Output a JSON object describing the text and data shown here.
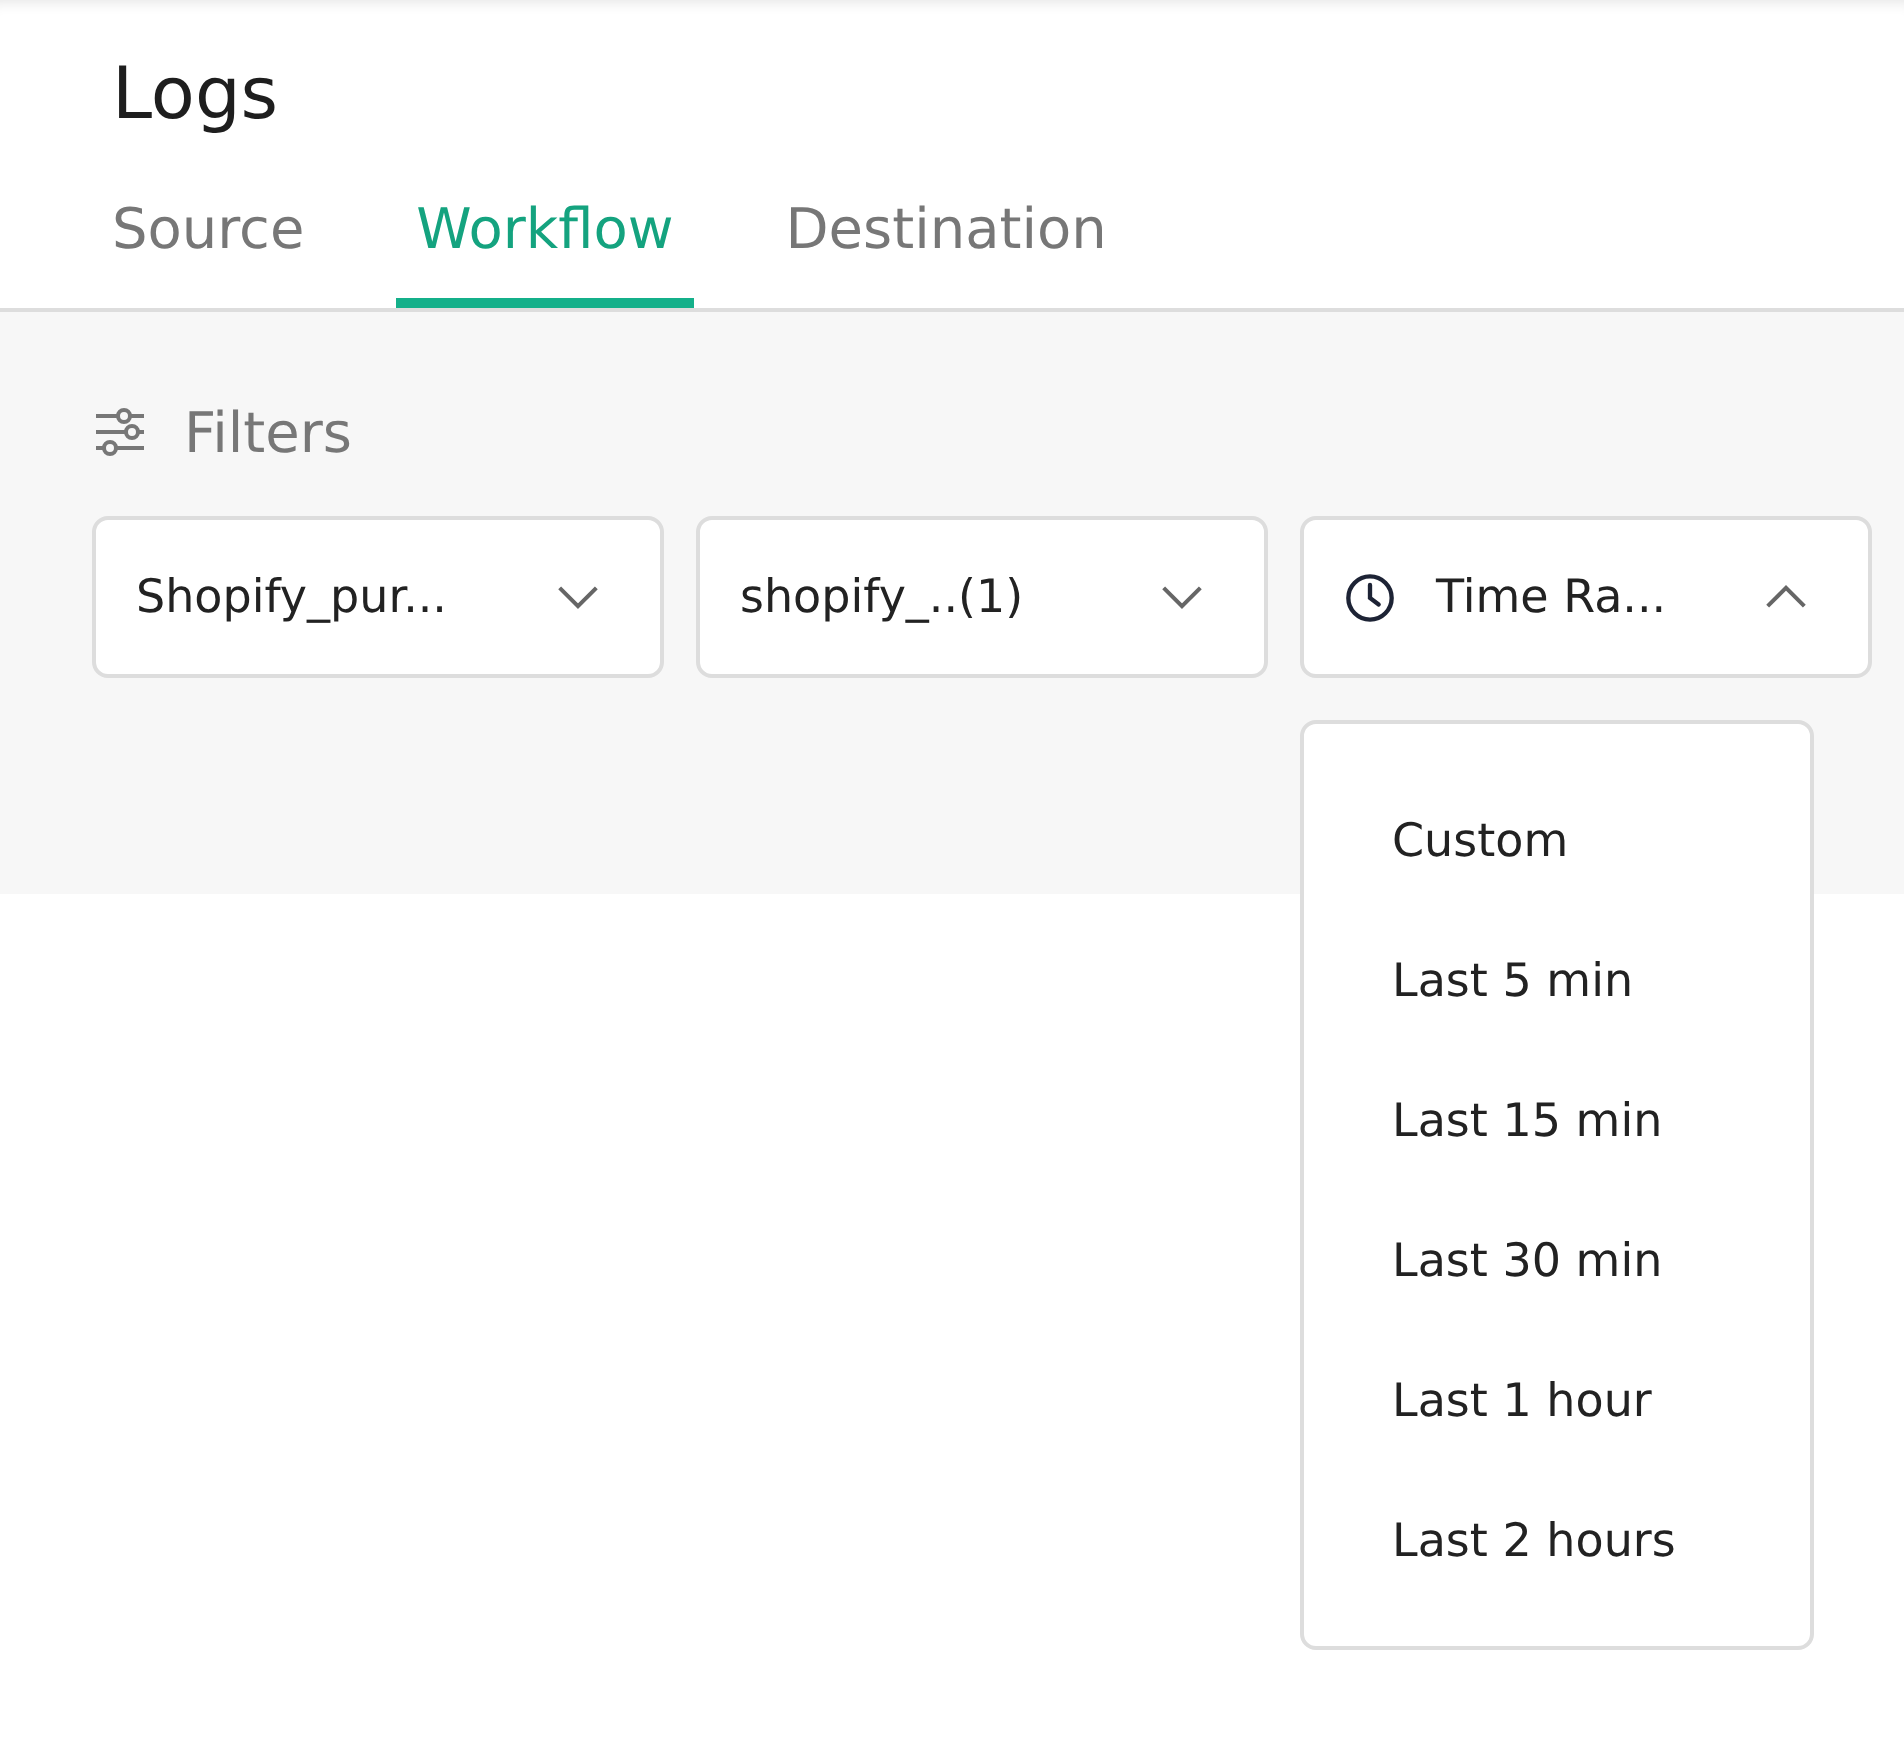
{
  "header": {
    "title": "Logs"
  },
  "tabs": [
    {
      "label": "Source",
      "selected": false
    },
    {
      "label": "Workflow",
      "selected": true
    },
    {
      "label": "Destination",
      "selected": false
    }
  ],
  "filters": {
    "label": "Filters",
    "selects": [
      {
        "kind": "plain",
        "value": "Shopify_pur...",
        "expanded": false
      },
      {
        "kind": "plain",
        "value": "shopify_..(1)",
        "expanded": false
      },
      {
        "kind": "time",
        "value": "Time Ra...",
        "expanded": true
      }
    ]
  },
  "dropdown": {
    "items": [
      "Custom",
      "Last 5 min",
      "Last 15 min",
      "Last 30 min",
      "Last 1 hour",
      "Last 2 hours"
    ]
  }
}
